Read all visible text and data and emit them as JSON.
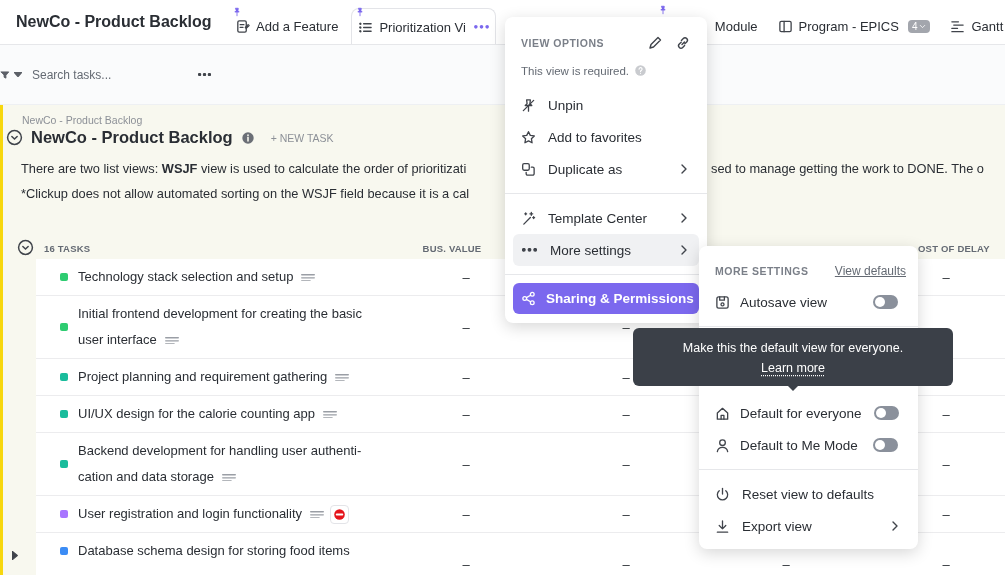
{
  "top_bar": {
    "title": "NewCo - Product Backlog",
    "tabs": [
      {
        "label": "Add a Feature",
        "pinned": true,
        "selected": false
      },
      {
        "label": "Prioritization Vi",
        "pinned": true,
        "selected": true
      },
      {
        "label": "Module",
        "pinned": true,
        "selected": false
      },
      {
        "label": "Program - EPICS",
        "pinned": false,
        "selected": false,
        "badge": "4"
      },
      {
        "label": "Gantt",
        "pinned": false,
        "selected": false
      }
    ]
  },
  "toolbar": {
    "search": {
      "placeholder": "Search tasks..."
    }
  },
  "list": {
    "breadcrumb": "NewCo - Product Backlog",
    "title": "NewCo - Product Backlog",
    "new_task": "+ NEW TASK",
    "description": [
      {
        "left": "There are two list views:  **WSJF** view is used to calculate the order of prioritizati",
        "right": "sed to manage getting the work to DONE.  The o"
      },
      {
        "left": "*Clickup does not allow automated sorting on the WSJF field because it is a cal"
      }
    ],
    "task_count": "16 TASKS",
    "columns": {
      "column_1": "BUS. VALUE",
      "column_4": "OST OF DELAY"
    },
    "rows": [
      {
        "name": "Technology stack selection and setup",
        "color": "#2ecc71",
        "has_description": true,
        "blocked": false,
        "expandable": false,
        "cells": {
          "column_1": "–",
          "column_4": "–"
        }
      },
      {
        "name": "Initial frontend development for creating the basic user interface",
        "color": "#2ecc71",
        "has_description": true,
        "blocked": false,
        "expandable": false,
        "cells": {
          "column_1": "–",
          "column_2": "–"
        }
      },
      {
        "name": "Project planning and requirement gathering",
        "color": "#1abc9c",
        "has_description": true,
        "blocked": false,
        "expandable": false,
        "cells": {
          "column_1": "–",
          "column_2": "–"
        }
      },
      {
        "name": "UI/UX design for the calorie counting app",
        "color": "#1abc9c",
        "has_description": true,
        "blocked": false,
        "expandable": false,
        "cells": {
          "column_1": "–",
          "column_2": "–",
          "column_4": "–"
        }
      },
      {
        "name": "Backend development for handling user authenti-cation and data storage",
        "color": "#1abc9c",
        "has_description": true,
        "blocked": false,
        "expandable": false,
        "cells": {
          "column_1": "–",
          "column_2": "–",
          "column_4": "–"
        }
      },
      {
        "name": "User registration and login functionality",
        "color": "#a875ff",
        "has_description": true,
        "blocked": true,
        "expandable": false,
        "cells": {
          "column_1": "–",
          "column_2": "–",
          "column_4": "–"
        }
      },
      {
        "name": "Database schema design for storing food items",
        "color": "#3b8cf5",
        "has_description": false,
        "blocked": false,
        "expandable": true,
        "cells": {
          "column_1": "–",
          "column_2": "–",
          "column_3": "–",
          "column_4": "–"
        }
      }
    ]
  },
  "view_options": {
    "heading": "VIEW OPTIONS",
    "note": "This view is required.",
    "items": [
      {
        "kind": "item",
        "label": "Unpin",
        "submenu": false,
        "highlighted": false
      },
      {
        "kind": "item",
        "label": "Add to favorites",
        "submenu": false,
        "highlighted": false
      },
      {
        "kind": "item",
        "label": "Duplicate as",
        "submenu": true,
        "highlighted": false
      },
      {
        "kind": "divider"
      },
      {
        "kind": "item",
        "label": "Template Center",
        "submenu": true,
        "highlighted": false
      },
      {
        "kind": "item",
        "label": "More settings",
        "submenu": true,
        "highlighted": true
      },
      {
        "kind": "divider"
      },
      {
        "kind": "button",
        "label": "Sharing & Permissions"
      }
    ]
  },
  "more_settings": {
    "heading": "MORE SETTINGS",
    "link": "View defaults",
    "items": [
      {
        "kind": "toggle",
        "label": "Autosave view",
        "on": false
      }
    ],
    "items_below": [
      {
        "kind": "toggle",
        "label": "Default for everyone",
        "on": false
      },
      {
        "kind": "toggle",
        "label": "Default to Me Mode",
        "on": false
      },
      {
        "kind": "divider"
      },
      {
        "kind": "item",
        "label": "Reset view to defaults",
        "submenu": false
      },
      {
        "kind": "item",
        "label": "Export view",
        "submenu": true
      }
    ]
  },
  "tooltip": {
    "text": "Make this the default view for everyone.",
    "link": "Learn more"
  }
}
